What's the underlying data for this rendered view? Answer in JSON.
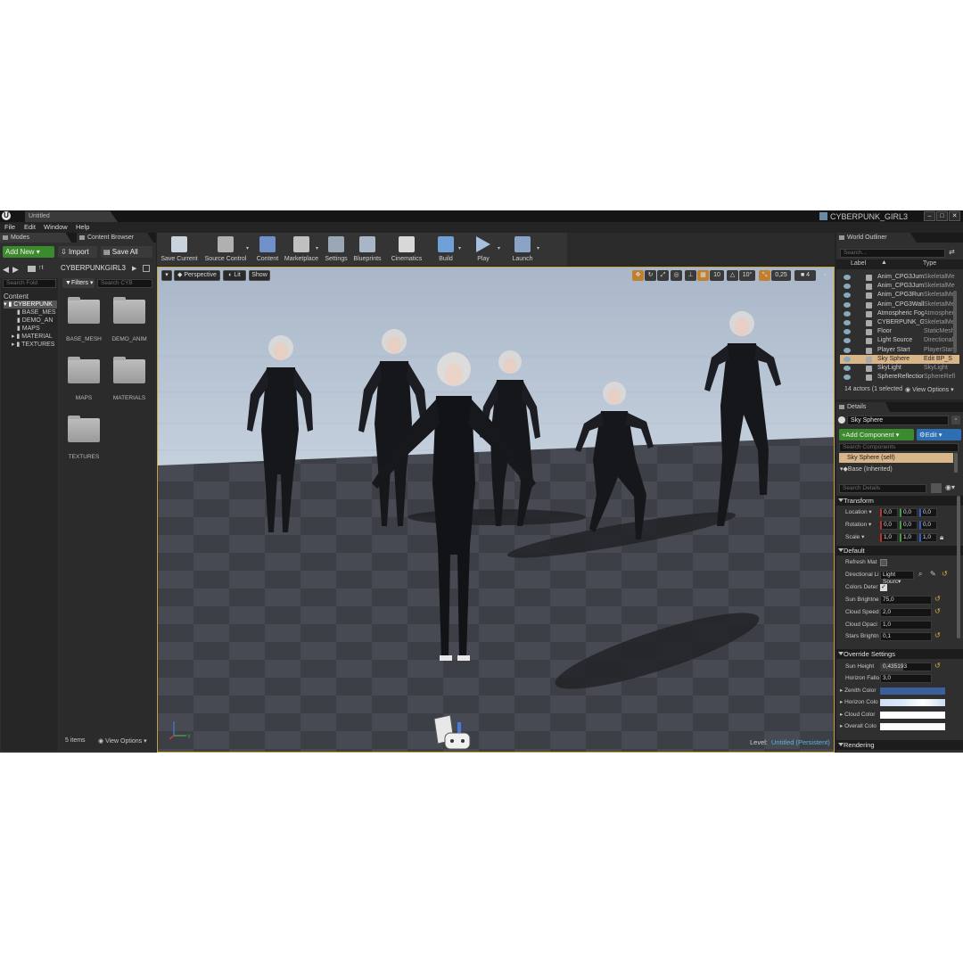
{
  "window": {
    "doc_tab": "Untitled",
    "project": "CYBERPUNK_GIRL3"
  },
  "menu": [
    "File",
    "Edit",
    "Window",
    "Help"
  ],
  "modes_tab": "Modes",
  "content_browser": {
    "tab": "Content Browser",
    "add_new": "Add New",
    "import": "Import",
    "save_all": "Save All",
    "path_short": "↑t",
    "path_current": "CYBERPUNKGIRL3",
    "search_folders": "Search Fold",
    "filters": "Filters",
    "search_assets": "Search CYB",
    "tree_root": "Content",
    "tree": [
      "CYBERPUNK",
      "BASE_MES",
      "DEMO_AN",
      "MAPS",
      "MATERIAL",
      "TEXTURES"
    ],
    "folders": [
      "BASE_MESH",
      "DEMO_ANIM",
      "MAPS",
      "MATERIALS",
      "TEXTURES"
    ],
    "item_count": "5 items",
    "view_options": "View Options"
  },
  "toolbar": [
    {
      "label": "Save Current",
      "icon": "save-icon",
      "color": "#c8d3de"
    },
    {
      "label": "Source Control",
      "icon": "source-control-icon",
      "color": "#b0b0b0"
    },
    {
      "label": "Content",
      "icon": "content-icon",
      "color": "#6f90c8"
    },
    {
      "label": "Marketplace",
      "icon": "marketplace-icon",
      "color": "#c0c0c0"
    },
    {
      "label": "Settings",
      "icon": "settings-icon",
      "color": "#9aa7b7"
    },
    {
      "label": "Blueprints",
      "icon": "blueprints-icon",
      "color": "#a8b6c8"
    },
    {
      "label": "Cinematics",
      "icon": "cinematics-icon",
      "color": "#d8d8d8"
    },
    {
      "label": "Build",
      "icon": "build-icon",
      "color": "#6fa0d8"
    },
    {
      "label": "Play",
      "icon": "play-icon",
      "color": "#a8c0e0"
    },
    {
      "label": "Launch",
      "icon": "launch-icon",
      "color": "#8aa4c8"
    }
  ],
  "viewport": {
    "perspective": "Perspective",
    "lit": "Lit",
    "show": "Show",
    "grid_snap": "10",
    "rot_snap": "10°",
    "scale_snap": "0,25",
    "cam_speed": "4",
    "level_label": "Level:",
    "level_name": "Untitled (Persistent)",
    "sky_color": "#b9c6d6",
    "floor_color": "#4a4d55"
  },
  "outliner": {
    "tab": "World Outliner",
    "search": "Search...",
    "col_label": "Label",
    "col_type": "Type",
    "rows": [
      {
        "label": "Anim_CPG3Jump",
        "type": "SkeletalMe",
        "selected": false
      },
      {
        "label": "Anim_CPG3Jump",
        "type": "SkeletalMe",
        "selected": false
      },
      {
        "label": "Anim_CPG3Run",
        "type": "SkeletalMe",
        "selected": false
      },
      {
        "label": "Anim_CPG3Walk",
        "type": "SkeletalMe",
        "selected": false
      },
      {
        "label": "Atmospheric Fog",
        "type": "Atmospher",
        "selected": false
      },
      {
        "label": "CYBERPUNK_GIR",
        "type": "SkeletalMe",
        "selected": false
      },
      {
        "label": "Floor",
        "type": "StaticMesh",
        "selected": false
      },
      {
        "label": "Light Source",
        "type": "Directional",
        "selected": false
      },
      {
        "label": "Player Start",
        "type": "PlayerStart",
        "selected": false
      },
      {
        "label": "Sky Sphere",
        "type": "Edit BP_S",
        "selected": true
      },
      {
        "label": "SkyLight",
        "type": "SkyLight",
        "selected": false
      },
      {
        "label": "SphereReflection",
        "type": "SphereRefl",
        "selected": false
      }
    ],
    "footer": "14 actors (1 selected",
    "view_options": "View Options"
  },
  "details": {
    "tab": "Details",
    "name": "Sky Sphere",
    "add_component": "Add Component",
    "edit": "Edit",
    "search_components": "Search Components",
    "self_row": "Sky Sphere (self)",
    "base_row": "Base (Inherited)",
    "search_details": "Search Details",
    "transform_hdr": "Transform",
    "location": {
      "label": "Location",
      "x": "0,0",
      "y": "0,0",
      "z": "0,0"
    },
    "rotation": {
      "label": "Rotation",
      "x": "0,0",
      "y": "0,0",
      "z": "0,0"
    },
    "scale": {
      "label": "Scale",
      "x": "1,0",
      "y": "1,0",
      "z": "1,0"
    },
    "default_hdr": "Default",
    "refresh": "Refresh Mat",
    "dir_light": "Directional Li",
    "dir_light_val": "Light Sourc",
    "colors_det": "Colors Deter",
    "sun_bright": {
      "label": "Sun Brightne",
      "value": "75,0"
    },
    "cloud_speed": {
      "label": "Cloud Speed",
      "value": "2,0"
    },
    "cloud_opac": {
      "label": "Cloud Opaci",
      "value": "1,0"
    },
    "stars_bright": {
      "label": "Stars Brightn",
      "value": "0,1"
    },
    "override_hdr": "Override Settings",
    "sun_height": {
      "label": "Sun Height",
      "value": "0,435193"
    },
    "horizon_falloff": {
      "label": "Horizon Fallo",
      "value": "3,0"
    },
    "zenith": {
      "label": "Zenith Color",
      "color": "#3a5f9a"
    },
    "horizon": {
      "label": "Horizon Colo",
      "color": "#d8e8f8"
    },
    "cloud_color": {
      "label": "Cloud Color",
      "color": "#ffffff"
    },
    "overall": {
      "label": "Overall Colo",
      "color": "#ffffff"
    },
    "rendering_hdr": "Rendering"
  }
}
